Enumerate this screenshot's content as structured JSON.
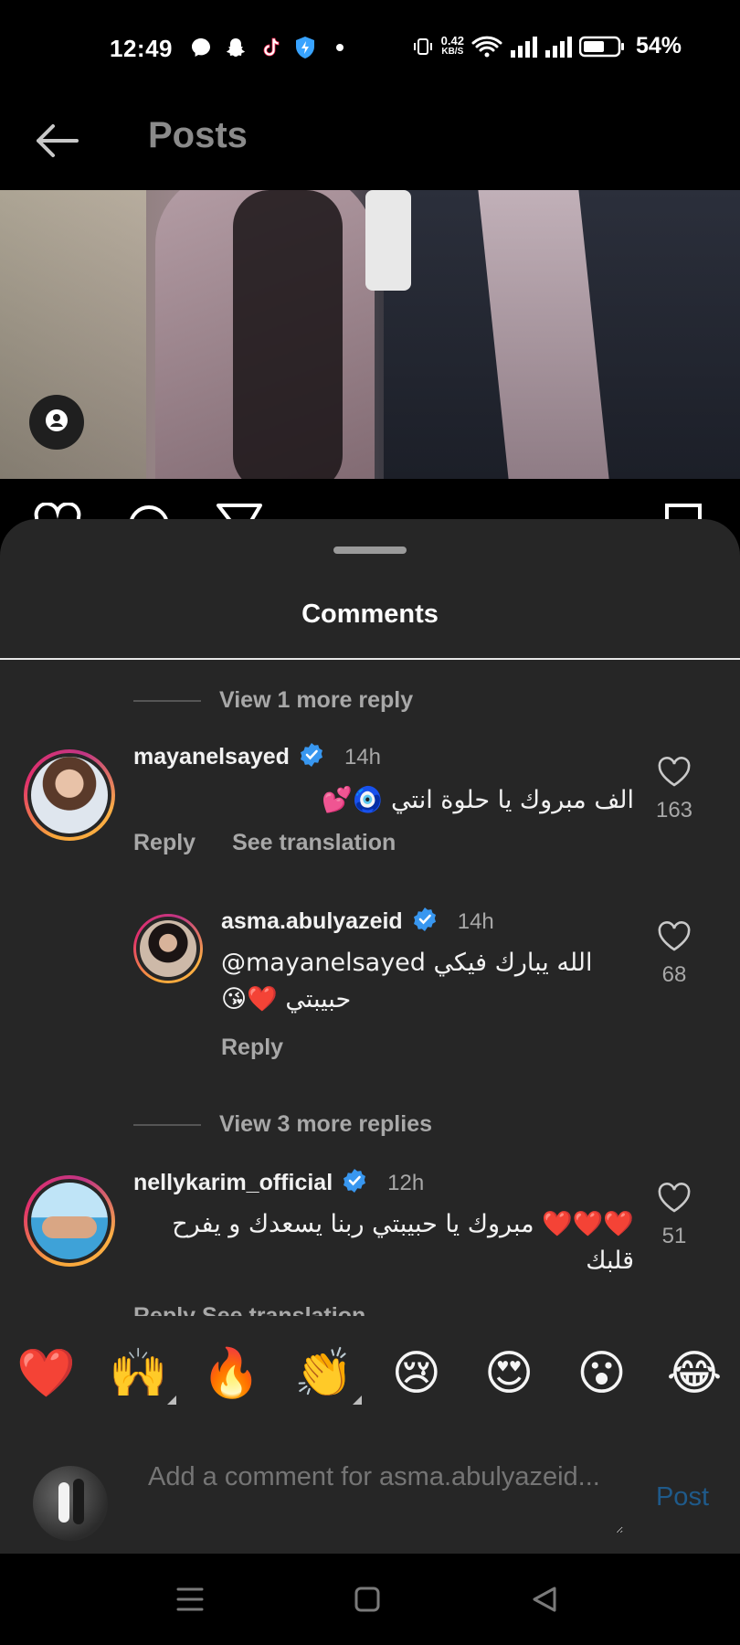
{
  "status_bar": {
    "time": "12:49",
    "net_speed_value": "0.42",
    "net_speed_unit": "KB/S",
    "battery": "54%",
    "icons": [
      "messenger-icon",
      "snapchat-icon",
      "tiktok-icon",
      "shield-icon",
      "vibrate-icon",
      "wifi-icon",
      "signal-icon",
      "signal-icon",
      "battery-icon"
    ]
  },
  "header": {
    "title": "Posts"
  },
  "sheet": {
    "title": "Comments"
  },
  "comments": {
    "view_more_1": "View 1 more reply",
    "view_more_2": "View 3 more replies",
    "items": [
      {
        "username": "mayanelsayed",
        "time": "14h",
        "text": "الف مبروك يا حلوة انتي 🧿💕",
        "reply": "Reply",
        "translate": "See translation",
        "likes": "163"
      },
      {
        "username": "asma.abulyazeid",
        "time": "14h",
        "text_line1": "@mayanelsayed الله يبارك فيكي",
        "text_line2": "حبيبتي ❤️😘",
        "reply": "Reply",
        "likes": "68"
      },
      {
        "username": "nellykarim_official",
        "time": "12h",
        "text_line1": "❤️❤️❤️ مبروك يا حبيبتي ربنا يسعدك و يفرح",
        "text_line2": "قلبك",
        "partial_actions": "Reply See translation",
        "likes": "51"
      }
    ]
  },
  "reactions": [
    "❤️",
    "🙌",
    "🔥",
    "👏",
    "😢",
    "😍",
    "😮",
    "😂"
  ],
  "input": {
    "placeholder": "Add a comment for asma.abulyazeid...",
    "post_label": "Post"
  },
  "colors": {
    "sheet_bg": "#262626",
    "verified": "#3897f0",
    "post_button": "#1f5a8a"
  }
}
